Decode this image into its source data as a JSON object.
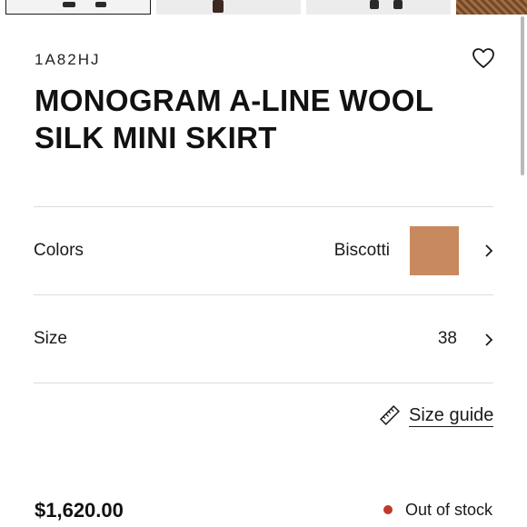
{
  "gallery": {
    "thumbnails": [
      {
        "label": "thumbnail 1",
        "selected": true
      },
      {
        "label": "thumbnail 2",
        "selected": false
      },
      {
        "label": "thumbnail 3",
        "selected": false
      },
      {
        "label": "thumbnail 4",
        "selected": false
      }
    ]
  },
  "product": {
    "sku": "1A82HJ",
    "title": "MONOGRAM A-LINE WOOL SILK MINI SKIRT",
    "wishlist_icon": "heart-icon"
  },
  "options": {
    "colors": {
      "label": "Colors",
      "value": "Biscotti",
      "swatch_color": "#c8895e",
      "icon": "chevron-right-icon"
    },
    "size": {
      "label": "Size",
      "value": "38",
      "icon": "chevron-right-icon"
    }
  },
  "size_guide": {
    "label": "Size guide",
    "icon": "ruler-icon"
  },
  "purchase": {
    "price": "$1,620.00",
    "stock_status": "Out of stock",
    "stock_status_color": "#c0392b"
  }
}
